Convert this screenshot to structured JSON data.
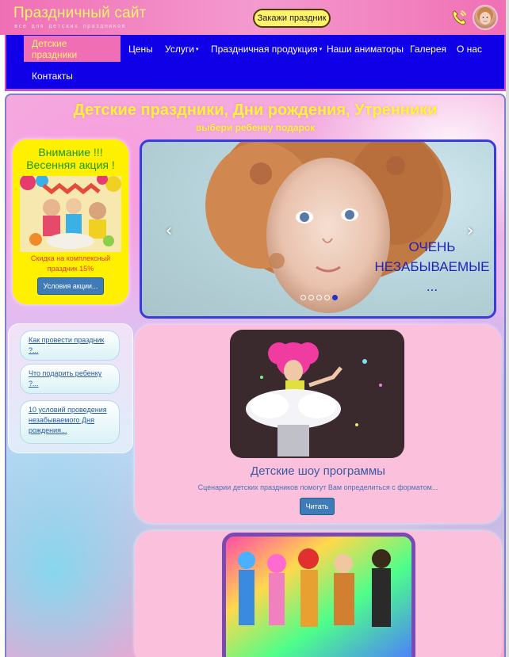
{
  "header": {
    "site_title": "Праздничный сайт",
    "site_subtitle": "все для детских праздников",
    "order_button": "Закажи праздник"
  },
  "nav": {
    "items": [
      {
        "label": "Детские праздники",
        "active": true
      },
      {
        "label": "Цены"
      },
      {
        "label": "Услуги",
        "dropdown": true
      },
      {
        "label": "Праздничная продукция",
        "dropdown": true
      },
      {
        "label": "Наши аниматоры"
      },
      {
        "label": "Галерея"
      },
      {
        "label": "О нас"
      },
      {
        "label": "Контакты"
      }
    ],
    "caret": "▾"
  },
  "main": {
    "title": "Детские праздники, Дни рождения, Утренники",
    "subtitle": "выбери ребенку подарок"
  },
  "promo": {
    "title_line1": "Внимание !!!",
    "title_line2": "Весенняя акция !",
    "text": "Скидка на комплексный праздник 15%",
    "button": "Условия акции..."
  },
  "carousel": {
    "caption_line1": "ОЧЕНЬ",
    "caption_line2": "НЕЗАБЫВАЕМЫЕ",
    "caption_line3": "...",
    "prev": "‹",
    "next": "›",
    "slide_count": 5,
    "active_slide": 4
  },
  "sidebar_links": [
    {
      "label": "Как провести праздник ?..."
    },
    {
      "label": "Что подарить ребенку ?..."
    },
    {
      "label": "10 условий проведения незабываемого Дня рождения..."
    }
  ],
  "cards": [
    {
      "title": "Детские шоу программы",
      "desc": "Сценарии детских праздников помогут Вам определиться с форматом...",
      "button": "Читать"
    },
    {
      "title": "",
      "desc": "",
      "button": ""
    }
  ],
  "colors": {
    "header_pink": "#f06fb4",
    "nav_blue": "#0f00e8",
    "title_yellow": "#fff536",
    "promo_yellow": "#fff000",
    "button_blue": "#3f7bb7",
    "card_pink": "#fbc0dc"
  }
}
